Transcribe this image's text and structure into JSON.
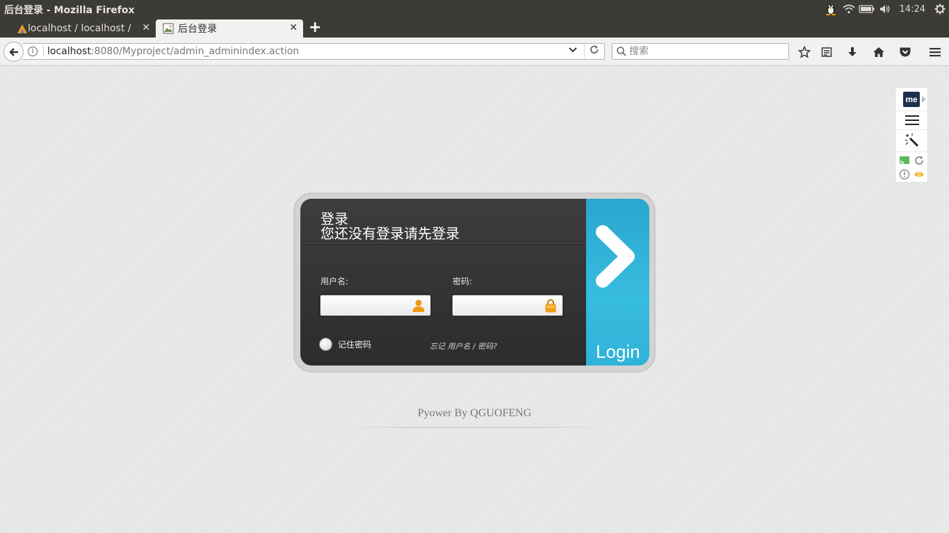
{
  "window": {
    "title": "后台登录 - Mozilla Firefox"
  },
  "tray": {
    "clock": "14:24"
  },
  "tabs": [
    {
      "label": "localhost / localhost / ",
      "active": false
    },
    {
      "label": "后台登录",
      "active": true
    }
  ],
  "navbar": {
    "url_host": "localhost",
    "url_rest": ":8080/Myproject/admin_adminindex.action",
    "search_placeholder": "搜索"
  },
  "extension": {
    "badge": "me"
  },
  "login": {
    "title": "登录",
    "subtitle": "您还没有登录请先登录",
    "username_label": "用户名:",
    "password_label": "密码:",
    "username_value": "",
    "password_value": "",
    "remember_label": "记住密码",
    "forgot_prefix": "忘记 ",
    "forgot_link": "用户名 / 密码?",
    "submit_label": "Login"
  },
  "footer": {
    "text": "Pyower By QGUOFENG"
  },
  "colors": {
    "accent_blue": "#37bde0",
    "card_dark": "#333333",
    "icon_orange": "#f29a11"
  }
}
